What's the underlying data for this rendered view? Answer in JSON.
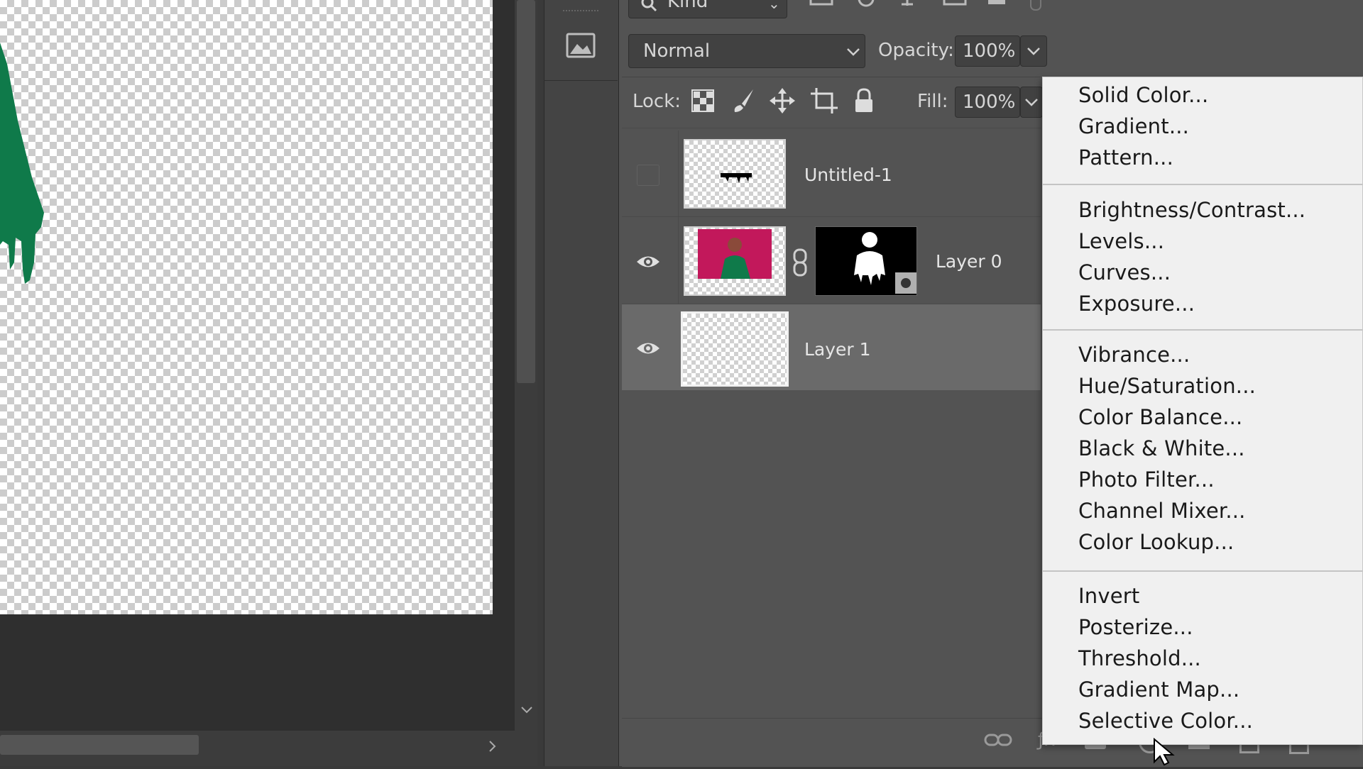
{
  "filter_bar": {
    "search_label": "Kind"
  },
  "blend": {
    "mode": "Normal",
    "opacity_label": "Opacity:",
    "opacity_value": "100%"
  },
  "lock": {
    "label": "Lock:",
    "fill_label": "Fill:",
    "fill_value": "100%"
  },
  "layers": [
    {
      "name": "Untitled-1",
      "visible": false
    },
    {
      "name": "Layer 0",
      "visible": true,
      "has_mask": true
    },
    {
      "name": "Layer 1",
      "visible": true,
      "selected": true
    }
  ],
  "menu": {
    "groups": [
      [
        "Solid Color...",
        "Gradient...",
        "Pattern..."
      ],
      [
        "Brightness/Contrast...",
        "Levels...",
        "Curves...",
        "Exposure..."
      ],
      [
        "Vibrance...",
        "Hue/Saturation...",
        "Color Balance...",
        "Black & White...",
        "Photo Filter...",
        "Channel Mixer...",
        "Color Lookup..."
      ],
      [
        "Invert",
        "Posterize...",
        "Threshold...",
        "Gradient Map...",
        "Selective Color..."
      ]
    ]
  },
  "colors": {
    "panel_bg": "#535353",
    "selected_row": "#6a6a6a",
    "menu_bg": "#f0f0f0",
    "canvas_green": "#0f7a4a",
    "thumb_magenta": "#c2185b"
  }
}
